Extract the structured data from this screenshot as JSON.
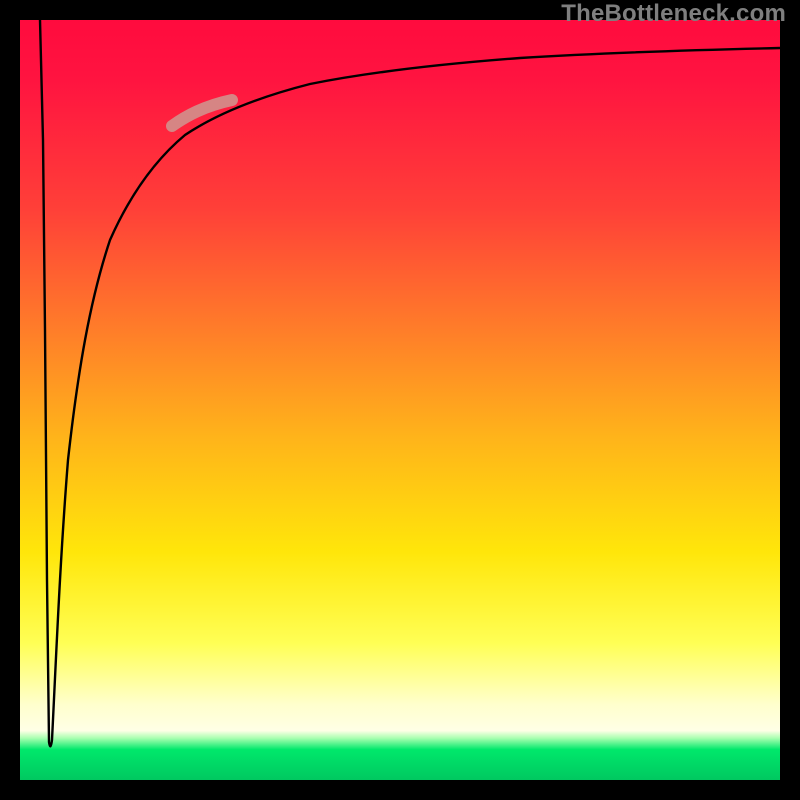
{
  "watermark": "TheBottleneck.com",
  "chart_data": {
    "type": "line",
    "title": "",
    "xlabel": "",
    "ylabel": "",
    "xlim": [
      0,
      100
    ],
    "ylim": [
      0,
      100
    ],
    "grid": false,
    "series": [
      {
        "name": "curve",
        "x": [
          2.5,
          3.0,
          3.3,
          3.6,
          4.2,
          5.0,
          6.0,
          8.0,
          10.0,
          13.0,
          16.0,
          20.0,
          26.0,
          34.0,
          45.0,
          60.0,
          78.0,
          100.0
        ],
        "y": [
          100,
          60,
          25,
          5,
          10,
          30,
          45,
          60,
          70,
          77,
          82,
          86,
          89,
          91.5,
          93,
          94.3,
          95.2,
          96
        ]
      }
    ],
    "highlight_segment": {
      "series": "curve",
      "x_from": 20,
      "x_to": 28,
      "color": "#d48b88",
      "width": 12
    },
    "background_gradient": {
      "direction": "vertical",
      "stops": [
        {
          "pos": 0.0,
          "color": "#ff0b3e"
        },
        {
          "pos": 0.25,
          "color": "#ff4038"
        },
        {
          "pos": 0.55,
          "color": "#ffb41a"
        },
        {
          "pos": 0.82,
          "color": "#ffff55"
        },
        {
          "pos": 0.92,
          "color": "#ffffe0"
        },
        {
          "pos": 0.96,
          "color": "#00e86b"
        },
        {
          "pos": 1.0,
          "color": "#00c860"
        }
      ]
    }
  }
}
